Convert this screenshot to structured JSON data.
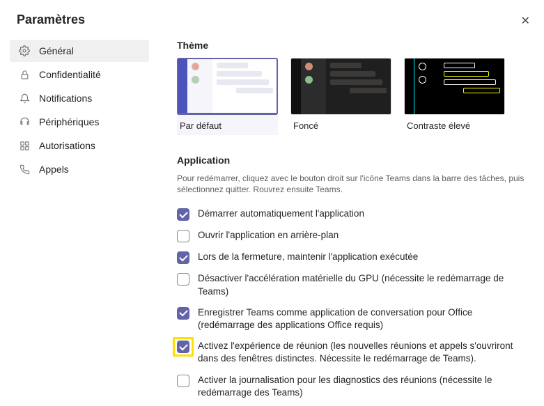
{
  "window_title": "Paramètres",
  "sidebar": {
    "items": [
      {
        "label": "Général",
        "active": true
      },
      {
        "label": "Confidentialité",
        "active": false
      },
      {
        "label": "Notifications",
        "active": false
      },
      {
        "label": "Périphériques",
        "active": false
      },
      {
        "label": "Autorisations",
        "active": false
      },
      {
        "label": "Appels",
        "active": false
      }
    ]
  },
  "theme_section": {
    "title": "Thème",
    "options": [
      {
        "label": "Par défaut",
        "active": true
      },
      {
        "label": "Foncé",
        "active": false
      },
      {
        "label": "Contraste élevé",
        "active": false
      }
    ]
  },
  "app_section": {
    "title": "Application",
    "help": "Pour redémarrer, cliquez avec le bouton droit sur l'icône Teams dans la barre des tâches, puis sélectionnez quitter. Rouvrez ensuite Teams.",
    "options": [
      {
        "label": "Démarrer automatiquement l'application",
        "checked": true,
        "highlight": false
      },
      {
        "label": "Ouvrir l'application en arrière-plan",
        "checked": false,
        "highlight": false
      },
      {
        "label": "Lors de la fermeture, maintenir l'application exécutée",
        "checked": true,
        "highlight": false
      },
      {
        "label": "Désactiver l'accélération matérielle du GPU (nécessite le redémarrage de Teams)",
        "checked": false,
        "highlight": false
      },
      {
        "label": "Enregistrer Teams comme application de conversation pour Office (redémarrage des applications Office requis)",
        "checked": true,
        "highlight": false
      },
      {
        "label": "Activez l'expérience de réunion (les nouvelles réunions et appels s'ouvriront dans des fenêtres distinctes. Nécessite le redémarrage de Teams).",
        "checked": true,
        "highlight": true
      },
      {
        "label": "Activer la journalisation pour les diagnostics des réunions (nécessite le redémarrage des Teams)",
        "checked": false,
        "highlight": false
      }
    ]
  }
}
